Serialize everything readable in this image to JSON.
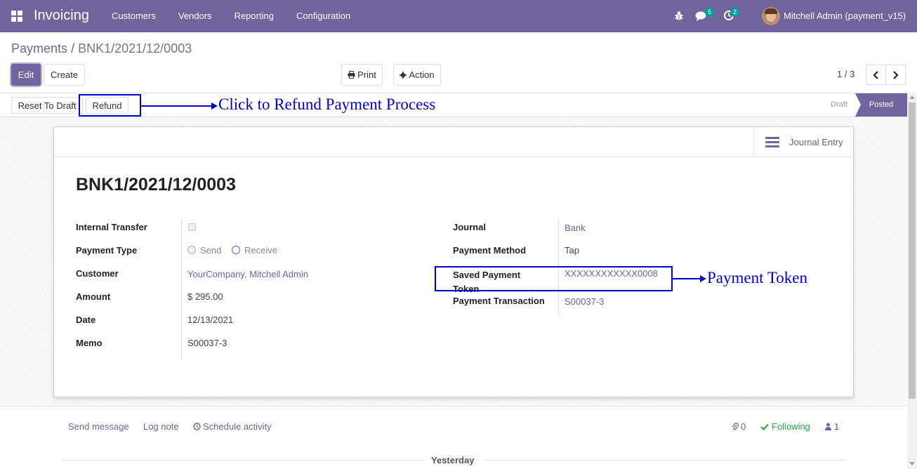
{
  "navbar": {
    "app_title": "Invoicing",
    "menu": [
      "Customers",
      "Vendors",
      "Reporting",
      "Configuration"
    ],
    "messages_count": "5",
    "activities_count": "2",
    "user_name": "Mitchell Admin (payment_v15)"
  },
  "breadcrumb": {
    "parent": "Payments",
    "separator": "/",
    "current": "BNK1/2021/12/0003"
  },
  "actions": {
    "edit": "Edit",
    "create": "Create",
    "print": "Print",
    "action": "Action"
  },
  "pager": {
    "value": "1 / 3"
  },
  "statusbar": {
    "reset_to_draft": "Reset To Draft",
    "refund": "Refund",
    "states": [
      "Draft",
      "Posted"
    ],
    "active_state": "Posted"
  },
  "annotations": {
    "refund_note": "Click to Refund Payment Process",
    "token_note": "Payment Token"
  },
  "sheet": {
    "smart_button": "Journal Entry",
    "title": "BNK1/2021/12/0003",
    "left_fields": {
      "internal_transfer_label": "Internal Transfer",
      "payment_type_label": "Payment Type",
      "payment_type_options": [
        "Send",
        "Receive"
      ],
      "payment_type_selected": "Receive",
      "customer_label": "Customer",
      "customer_value": "YourCompany, Mitchell Admin",
      "amount_label": "Amount",
      "amount_value": "$ 295.00",
      "date_label": "Date",
      "date_value": "12/13/2021",
      "memo_label": "Memo",
      "memo_value": "S00037-3"
    },
    "right_fields": {
      "journal_label": "Journal",
      "journal_value": "Bank",
      "payment_method_label": "Payment Method",
      "payment_method_value": "Tap",
      "saved_token_label_line1": "Saved Payment",
      "saved_token_label_line2": "Token",
      "saved_token_value": "XXXXXXXXXXXX0008",
      "payment_transaction_label": "Payment Transaction",
      "payment_transaction_value": "S00037-3"
    }
  },
  "chatter": {
    "send_message": "Send message",
    "log_note": "Log note",
    "schedule_activity": "Schedule activity",
    "attachments_count": "0",
    "following": "Following",
    "followers_count": "1",
    "date_separator": "Yesterday"
  },
  "colors": {
    "brand": "#71639e",
    "annotation": "#0000cc",
    "badge": "#00a09d",
    "following": "#28a745"
  }
}
